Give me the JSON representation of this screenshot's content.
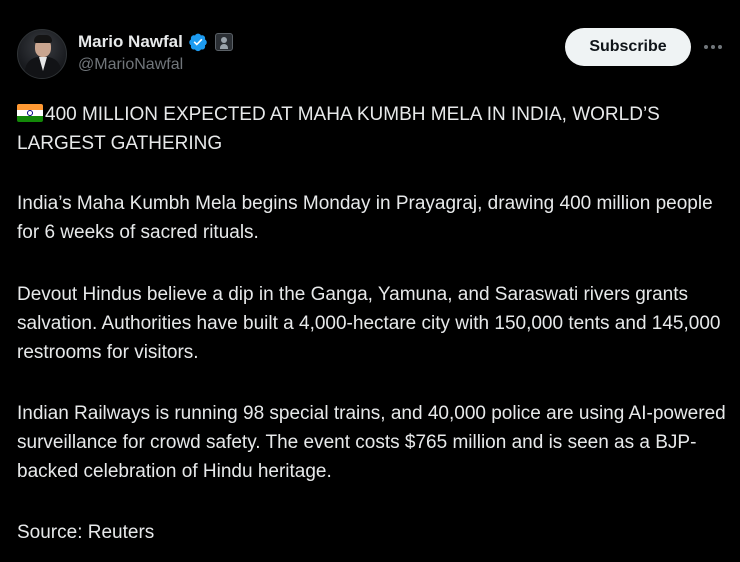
{
  "author": {
    "display_name": "Mario Nawfal",
    "handle": "@MarioNawfal"
  },
  "icons": {
    "verified": "verified-badge-icon",
    "affiliate": "affiliate-badge-icon",
    "flag": "india-flag-icon",
    "more": "more-options-icon"
  },
  "colors": {
    "background": "#000000",
    "text": "#e7e9ea",
    "secondary_text": "#71767b",
    "verified_blue": "#1d9bf0",
    "button_bg": "#eff3f4"
  },
  "actions": {
    "subscribe_label": "Subscribe"
  },
  "post": {
    "headline": "400 MILLION EXPECTED AT MAHA KUMBH MELA IN INDIA, WORLD’S LARGEST GATHERING",
    "paragraph1": "India’s Maha Kumbh Mela begins Monday in Prayagraj, drawing 400 million people for 6 weeks of sacred rituals.",
    "paragraph2": "Devout Hindus believe a dip in the Ganga, Yamuna, and Saraswati rivers grants salvation. Authorities have built a 4,000-hectare city with 150,000 tents and 145,000 restrooms for visitors.",
    "paragraph3": "Indian Railways is running 98 special trains, and 40,000 police are using AI-powered surveillance for crowd safety. The event costs $765 million and is seen as a BJP-backed celebration of Hindu heritage.",
    "source": "Source: Reuters"
  }
}
